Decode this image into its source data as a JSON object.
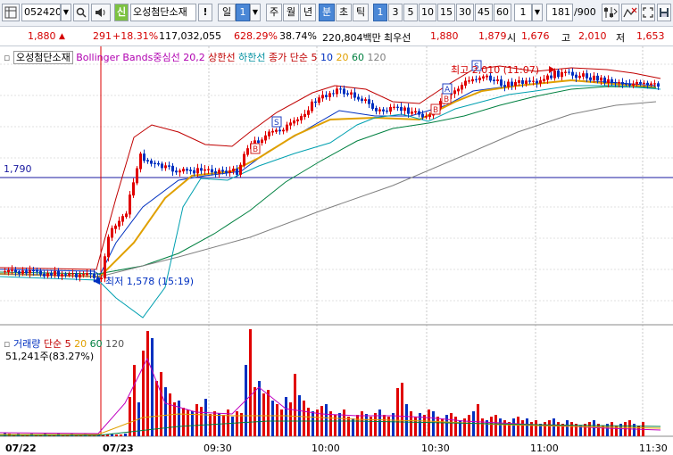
{
  "toolbar": {
    "stock_code": "052420",
    "new_badge": "신",
    "stock_name": "오성첨단소재",
    "warning": "!",
    "period_day": "일",
    "period_num": "1",
    "periods": [
      "주",
      "월",
      "년",
      "분",
      "초",
      "틱"
    ],
    "intervals": [
      "1",
      "3",
      "5",
      "10",
      "15",
      "30",
      "45",
      "60"
    ],
    "interval_value": "1",
    "count": "181",
    "count_total": "/900"
  },
  "quote": {
    "price": "1,880",
    "change": "291",
    "change_rate": "+18.31%",
    "volume": "117,032,055",
    "volume_rate": "628.29%",
    "turnover": "38.74%",
    "amount": "220,804백만",
    "ask_label": "최우선",
    "ask": "1,880",
    "bid": "1,879",
    "open_label": "시",
    "open": "1,676",
    "high_label": "고",
    "high": "2,010",
    "low_label": "저",
    "low": "1,653"
  },
  "legend": {
    "name": "오성첨단소재",
    "bollinger": "Bollinger Bands중심선 20,2",
    "upper": "상한선",
    "lower": "하한선",
    "ma_label": "종가 단순 5",
    "ma10": "10",
    "ma20": "20",
    "ma60": "60",
    "ma120": "120"
  },
  "volume_legend": {
    "title": "거래량",
    "ma": "단순 5",
    "v20": "20",
    "v60": "60",
    "v120": "120",
    "current": "51,241주(83.27%)"
  },
  "annotations": {
    "level_label": "1,790",
    "high_mark": "최고 2,010 (11:07)",
    "low_mark": "최저 1,578 (15:19)"
  },
  "x_axis": [
    "07/22",
    "07/23",
    "09:30",
    "10:00",
    "10:30",
    "11:00",
    "11:30"
  ],
  "colors": {
    "up": "#e00000",
    "down": "#0030c0",
    "ma5": "#e0a000",
    "bollinger": "#c00000",
    "lower": "#00a0b0",
    "ma60": "#008040",
    "ma120": "#808080"
  },
  "icons": [
    "grid-icon",
    "dropdown-icon",
    "search-icon",
    "phone-icon",
    "speaker-icon",
    "toggle-icon",
    "chart-tools-icon",
    "fullscreen-icon",
    "save-icon"
  ]
}
